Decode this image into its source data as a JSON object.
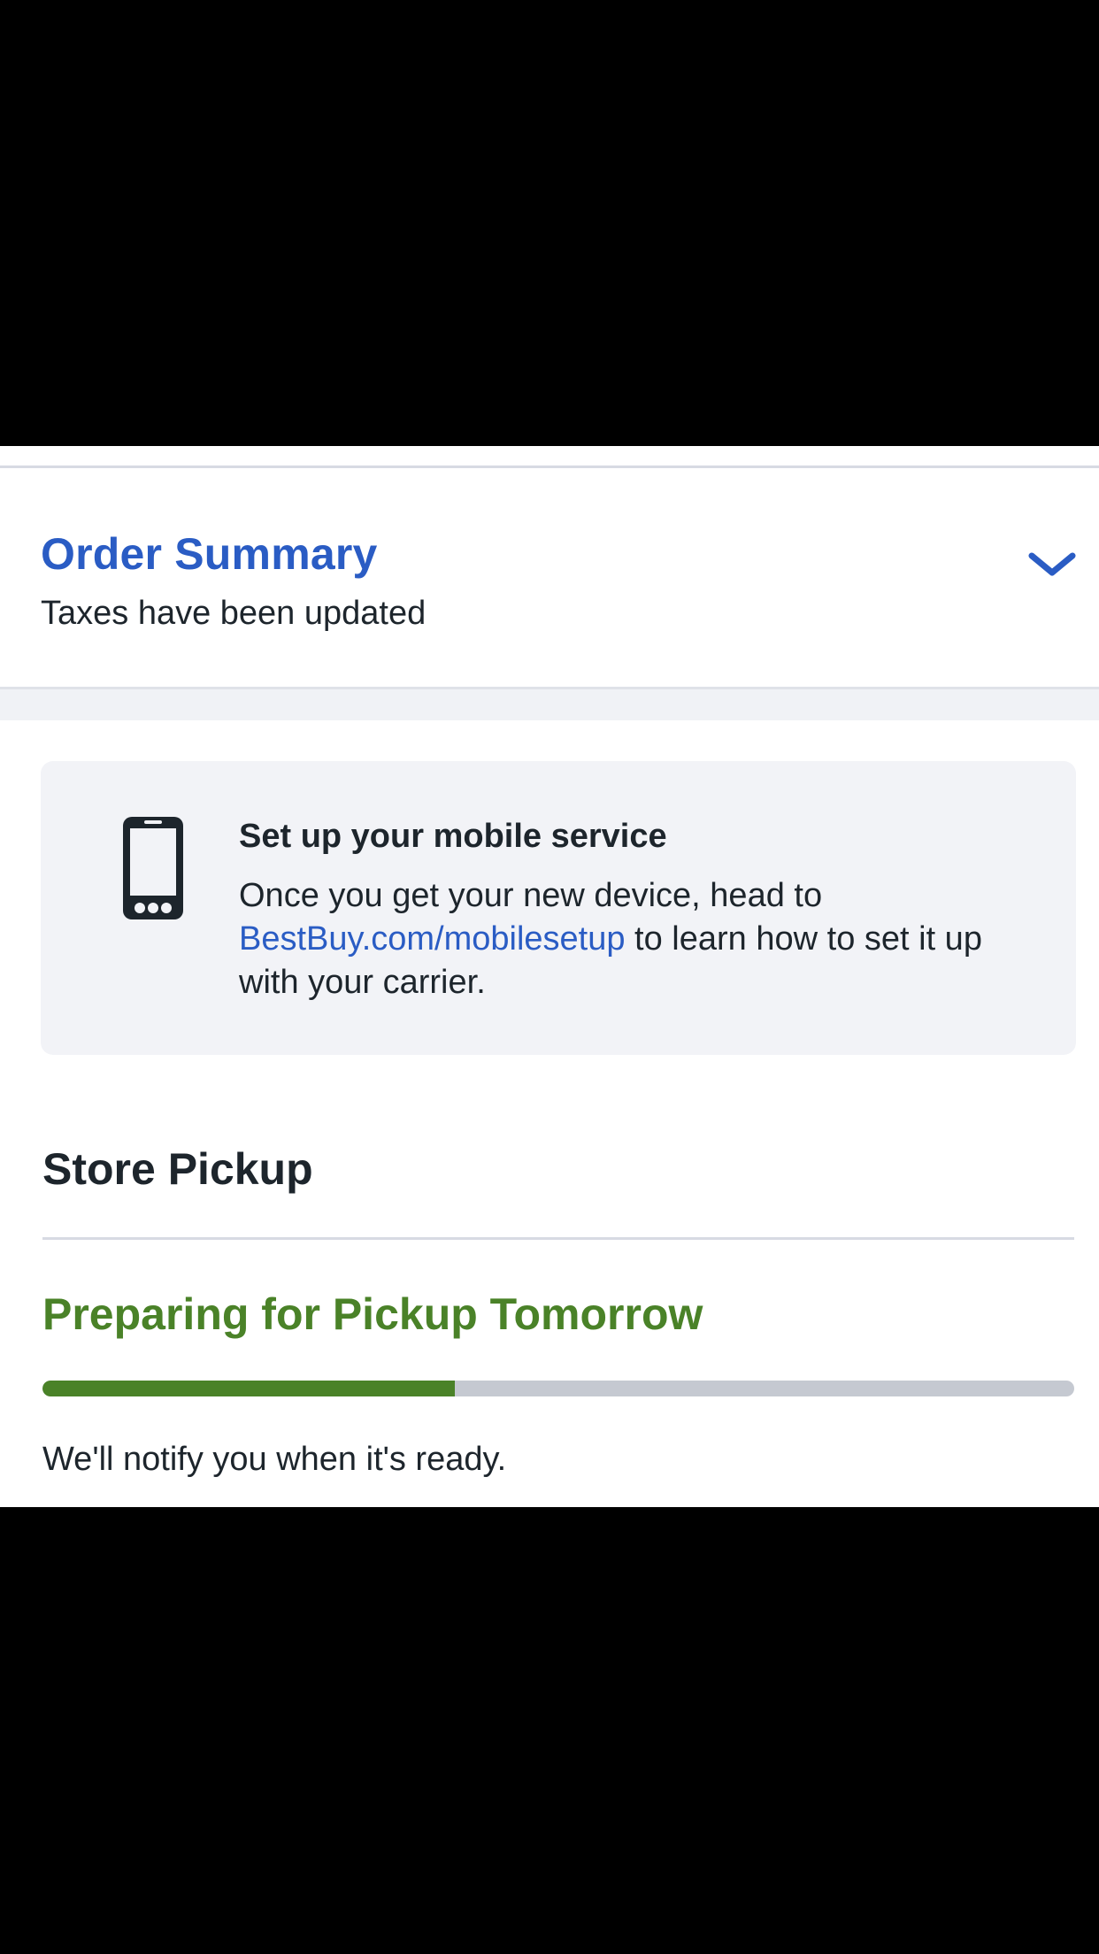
{
  "order_summary": {
    "title": "Order Summary",
    "subtitle": "Taxes have been updated",
    "toggle_icon": "chevron-down-icon",
    "accent_color": "#2a5cc4"
  },
  "mobile_service_card": {
    "icon": "smartphone-icon",
    "title": "Set up your mobile service",
    "body_before": "Once you get your new device, head to ",
    "link_text": "BestBuy.com/mobilesetup",
    "body_after": " to learn how to set it up with your carrier."
  },
  "store_pickup": {
    "title": "Store Pickup",
    "status": "Preparing for Pickup Tomorrow",
    "status_color": "#4a8228",
    "progress_fraction": 0.4,
    "notice": "We'll notify you when it's ready."
  }
}
